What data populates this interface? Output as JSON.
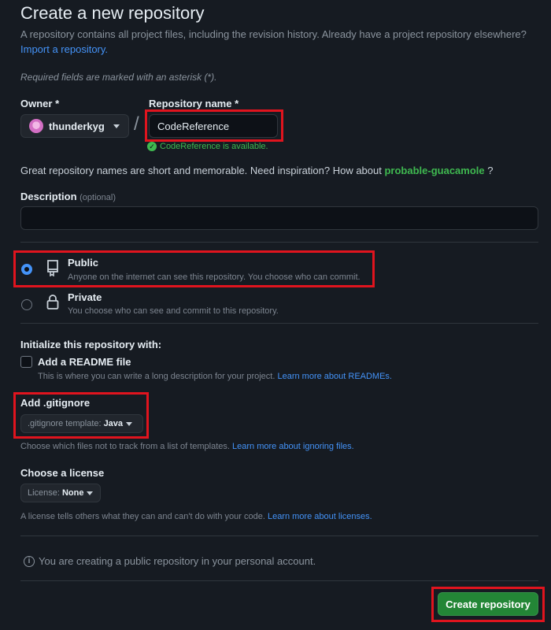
{
  "page": {
    "title": "Create a new repository",
    "subtitle": "A repository contains all project files, including the revision history. Already have a project repository elsewhere?",
    "import_link": "Import a repository.",
    "required_note": "Required fields are marked with an asterisk (*)."
  },
  "owner": {
    "label": "Owner *",
    "value": "thunderkyg"
  },
  "separator": "/",
  "repo_name": {
    "label": "Repository name *",
    "value": "CodeReference",
    "availability": "CodeReference is available."
  },
  "inspiration": {
    "text": "Great repository names are short and memorable. Need inspiration? How about",
    "suggestion": "probable-guacamole",
    "suffix": "?"
  },
  "description": {
    "label": "Description",
    "optional": "(optional)",
    "value": ""
  },
  "visibility": {
    "public": {
      "title": "Public",
      "desc": "Anyone on the internet can see this repository. You choose who can commit.",
      "selected": true
    },
    "private": {
      "title": "Private",
      "desc": "You choose who can see and commit to this repository.",
      "selected": false
    }
  },
  "initialize": {
    "heading": "Initialize this repository with:",
    "readme": {
      "label": "Add a README file",
      "desc": "This is where you can write a long description for your project.",
      "link": "Learn more about READMEs.",
      "checked": false
    }
  },
  "gitignore": {
    "heading": "Add .gitignore",
    "prefix": ".gitignore template:",
    "value": "Java",
    "help": "Choose which files not to track from a list of templates.",
    "link": "Learn more about ignoring files."
  },
  "license": {
    "heading": "Choose a license",
    "prefix": "License:",
    "value": "None",
    "help": "A license tells others what they can and can't do with your code.",
    "link": "Learn more about licenses."
  },
  "info_text": "You are creating a public repository in your personal account.",
  "create_button": "Create repository",
  "colors": {
    "background": "#161b22",
    "accent_blue": "#4493f8",
    "success_green": "#3fb950",
    "button_green": "#238636",
    "highlight_red": "#e0141e"
  },
  "icons": [
    "check-circle-icon",
    "repo-icon",
    "lock-icon",
    "info-icon",
    "caret-down-icon"
  ]
}
